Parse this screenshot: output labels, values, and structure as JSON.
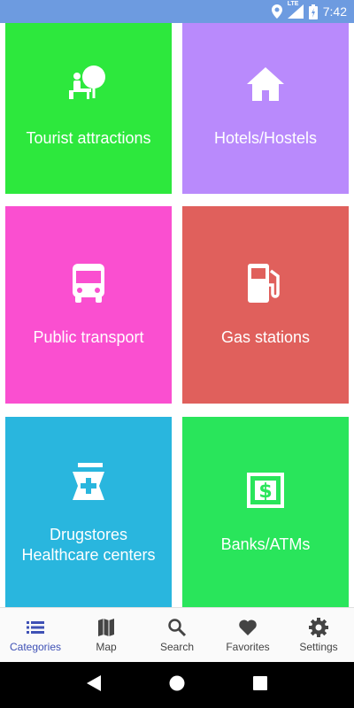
{
  "status": {
    "network": "LTE",
    "time": "7:42"
  },
  "colors": {
    "status_bar": "#6d9be0",
    "tourist": "#2de83d",
    "hotels": "#b98afc",
    "transport": "#fa4fd0",
    "gas": "#e0605c",
    "drugstores": "#29b6de",
    "banks": "#29e55b",
    "active_nav": "#3f51b5"
  },
  "categories": [
    {
      "label": "Tourist attractions",
      "icon": "tourist-attraction-icon"
    },
    {
      "label": "Hotels/Hostels",
      "icon": "home-icon"
    },
    {
      "label": "Public transport",
      "icon": "bus-icon"
    },
    {
      "label": "Gas stations",
      "icon": "gas-station-icon"
    },
    {
      "label": "Drugstores\nHealthcare centers",
      "icon": "pharmacy-icon"
    },
    {
      "label": "Banks/ATMs",
      "icon": "dollar-icon"
    }
  ],
  "nav": [
    {
      "label": "Categories",
      "icon": "list-icon",
      "active": true
    },
    {
      "label": "Map",
      "icon": "map-icon",
      "active": false
    },
    {
      "label": "Search",
      "icon": "search-icon",
      "active": false
    },
    {
      "label": "Favorites",
      "icon": "heart-icon",
      "active": false
    },
    {
      "label": "Settings",
      "icon": "gear-icon",
      "active": false
    }
  ]
}
